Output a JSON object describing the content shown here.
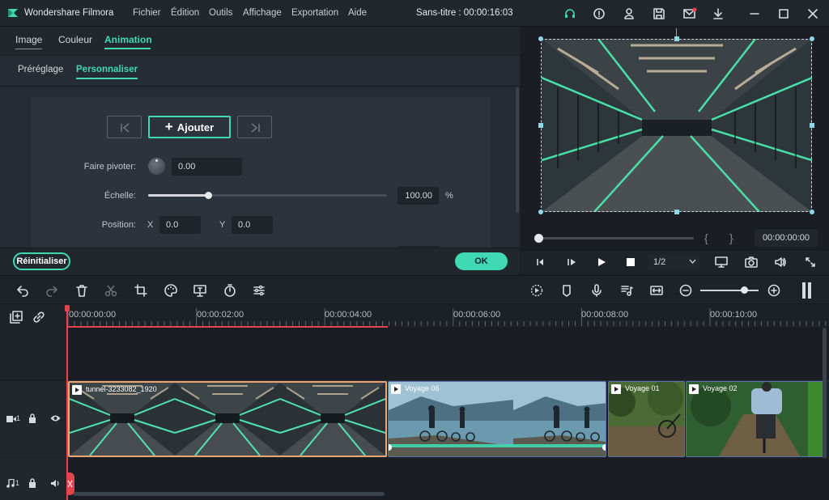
{
  "app": {
    "name": "Wondershare Filmora",
    "title": "Sans-titre : 00:00:16:03"
  },
  "menu": [
    "Fichier",
    "Édition",
    "Outils",
    "Affichage",
    "Exportation",
    "Aide"
  ],
  "tabs": [
    {
      "label": "Image",
      "active": false
    },
    {
      "label": "Couleur",
      "active": false
    },
    {
      "label": "Animation",
      "active": true
    }
  ],
  "subtabs": [
    {
      "label": "Préréglage",
      "active": false
    },
    {
      "label": "Personnaliser",
      "active": true
    }
  ],
  "keyframes": {
    "add_label": "Ajouter"
  },
  "props": {
    "rotate_label": "Faire pivoter:",
    "rotate_value": "0.00",
    "scale_label": "Échelle:",
    "scale_value": "100.00",
    "scale_unit": "%",
    "scale_fraction": 0.25,
    "position_label": "Position:",
    "x_label": "X",
    "x_value": "0.0",
    "y_label": "Y",
    "y_value": "0.0"
  },
  "buttons": {
    "reset": "Réinitialiser",
    "ok": "OK"
  },
  "player": {
    "time": "00:00:00:00",
    "quality": "1/2",
    "bracket_in": "{",
    "bracket_out": "}"
  },
  "ruler": [
    "00:00:00:00",
    "00:00:02:00",
    "00:00:04:00",
    "00:00:06:00",
    "00:00:08:00",
    "00:00:10:00"
  ],
  "tracks": {
    "video_label": "1",
    "audio_label": "1"
  },
  "clips": [
    {
      "name": "tunnel-3233082_1920"
    },
    {
      "name": "Voyage 06"
    },
    {
      "name": "Voyage 01"
    },
    {
      "name": "Voyage 02"
    }
  ],
  "colors": {
    "accent": "#3fd9b4",
    "playhead": "#e8434c",
    "selected_clip": "#f0a671"
  }
}
